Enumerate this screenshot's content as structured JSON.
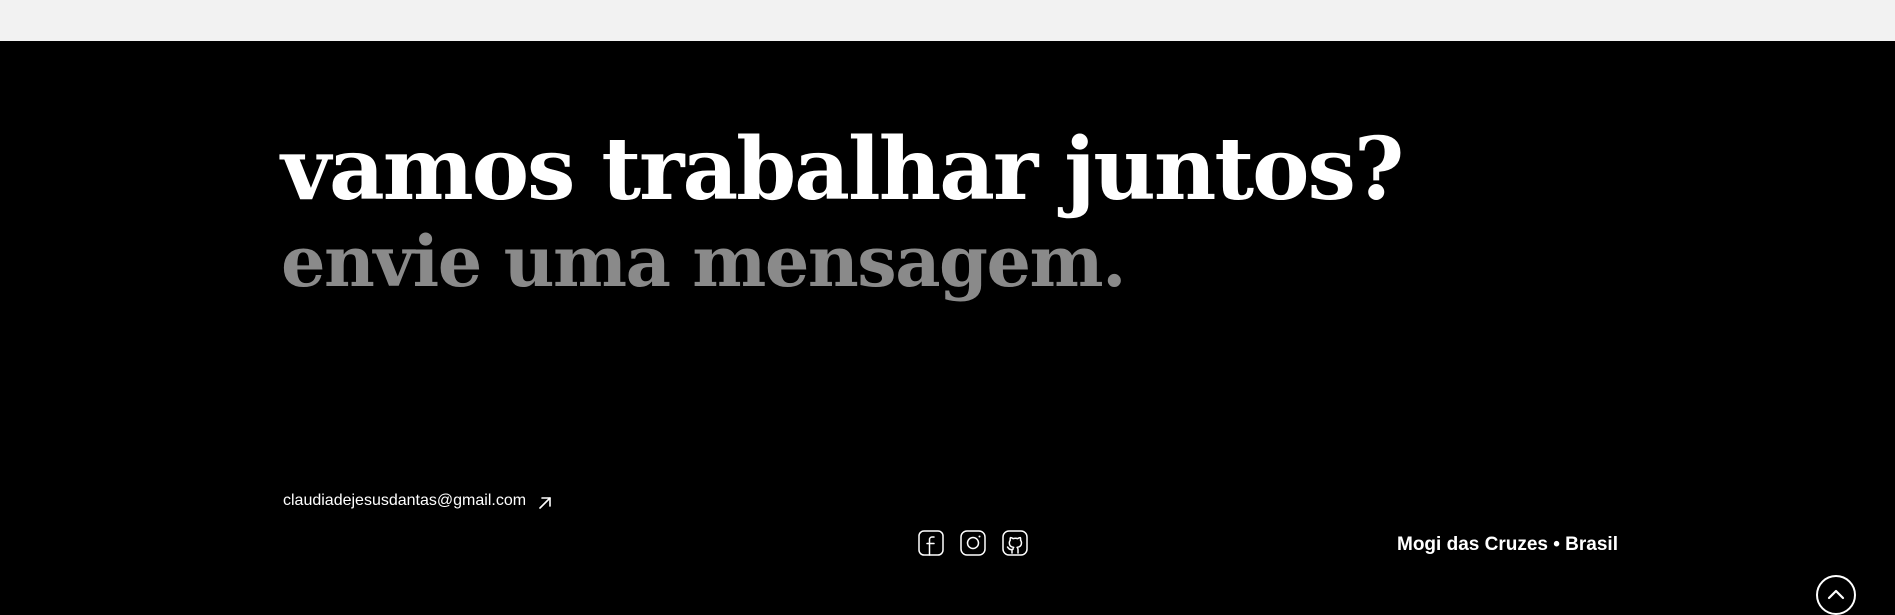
{
  "footer": {
    "headline": "vamos trabalhar juntos?",
    "subheadline": "envie uma mensagem.",
    "email": "claudiadejesusdantas@gmail.com",
    "location": "Mogi das Cruzes • Brasil",
    "social_icons": [
      "facebook-icon",
      "instagram-icon",
      "github-icon"
    ],
    "back_to_top_icon": "chevron-up-icon",
    "email_arrow_icon": "arrow-up-right-icon"
  },
  "colors": {
    "top_strip": "#f2f2f2",
    "background": "#000000",
    "headline": "#ffffff",
    "subheadline": "#8a8a8a",
    "text": "#ffffff"
  }
}
